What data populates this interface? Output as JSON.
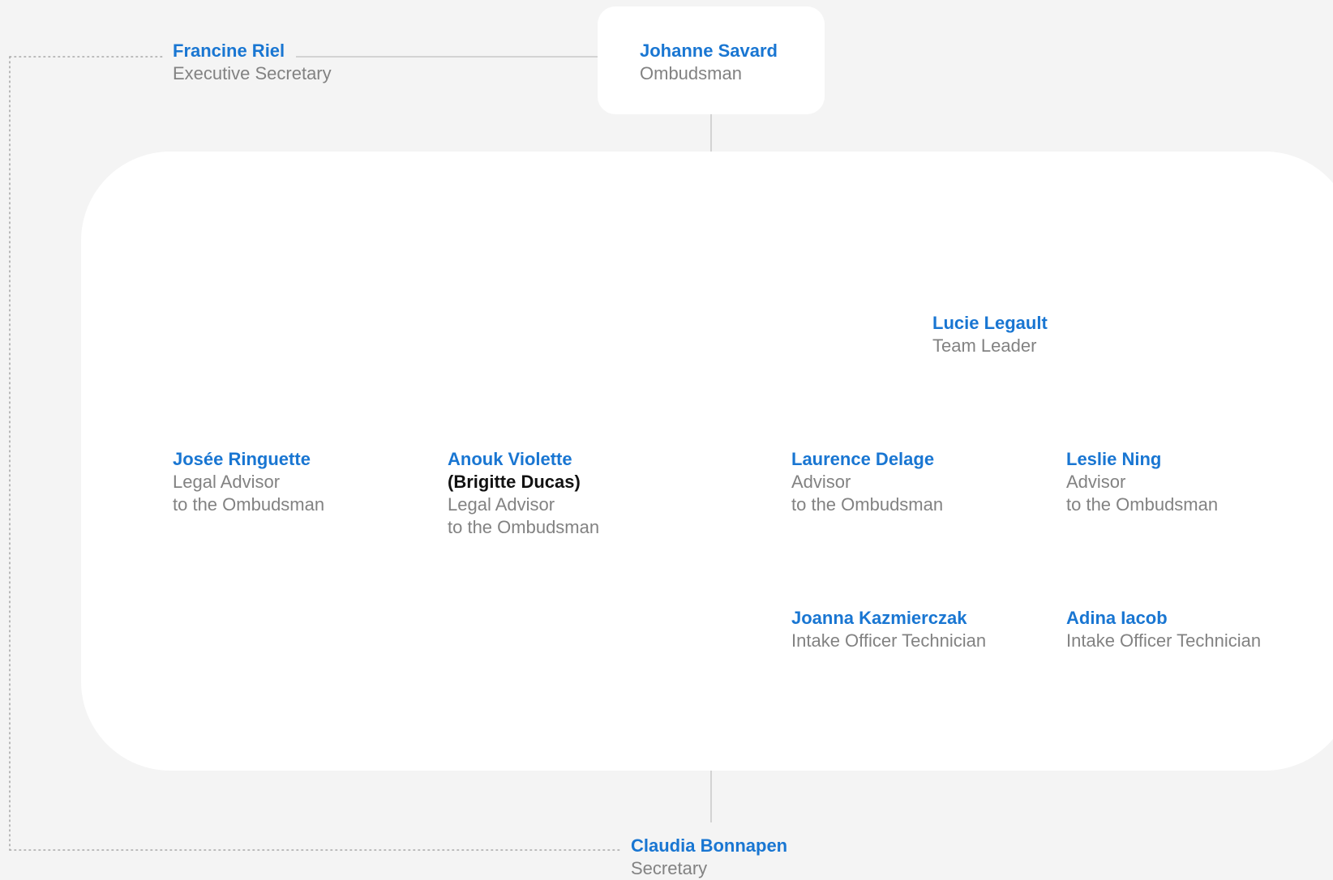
{
  "colors": {
    "name": "#1976d2",
    "role": "#828282",
    "line": "#c8c8c8",
    "background": "#f4f4f4",
    "card": "#ffffff"
  },
  "nodes": {
    "ombudsman": {
      "name": "Johanne Savard",
      "role": [
        "Ombudsman"
      ]
    },
    "exec_secretary": {
      "name": "Francine Riel",
      "role": [
        "Executive Secretary"
      ]
    },
    "team_leader": {
      "name": "Lucie Legault",
      "role": [
        "Team Leader"
      ]
    },
    "legal_advisor_1": {
      "name": "Josée Ringuette",
      "role": [
        "Legal Advisor",
        "to the Ombudsman"
      ]
    },
    "legal_advisor_2": {
      "name": "Anouk Violette",
      "alt": "(Brigitte Ducas)",
      "role": [
        "Legal Advisor",
        "to the Ombudsman"
      ]
    },
    "advisor_1": {
      "name": "Laurence Delage",
      "role": [
        "Advisor",
        "to the Ombudsman"
      ]
    },
    "advisor_2": {
      "name": "Leslie Ning",
      "role": [
        "Advisor",
        "to the Ombudsman"
      ]
    },
    "intake_1": {
      "name": "Joanna Kazmierczak",
      "role": [
        "Intake Officer Technician"
      ]
    },
    "intake_2": {
      "name": "Adina Iacob",
      "role": [
        "Intake Officer Technician"
      ]
    },
    "secretary": {
      "name": "Claudia Bonnapen",
      "role": [
        "Secretary"
      ]
    }
  }
}
